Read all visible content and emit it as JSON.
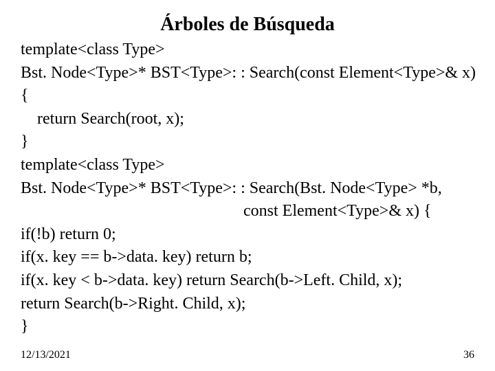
{
  "title": "Árboles de Búsqueda",
  "code": {
    "l1": "template<class Type>",
    "l2": "Bst. Node<Type>* BST<Type>: : Search(const Element<Type>& x)",
    "l3": "{",
    "l4": "    return Search(root, x);",
    "l5": "}",
    "l6": "template<class Type>",
    "l7": "Bst. Node<Type>* BST<Type>: : Search(Bst. Node<Type> *b,",
    "l8": "                                                      const Element<Type>& x) {",
    "l9": "if(!b) return 0;",
    "l10": "if(x. key == b->data. key) return b;",
    "l11": "if(x. key < b->data. key) return Search(b->Left. Child, x);",
    "l12": "return Search(b->Right. Child, x);",
    "l13": "}"
  },
  "footer": {
    "date": "12/13/2021",
    "page": "36"
  }
}
